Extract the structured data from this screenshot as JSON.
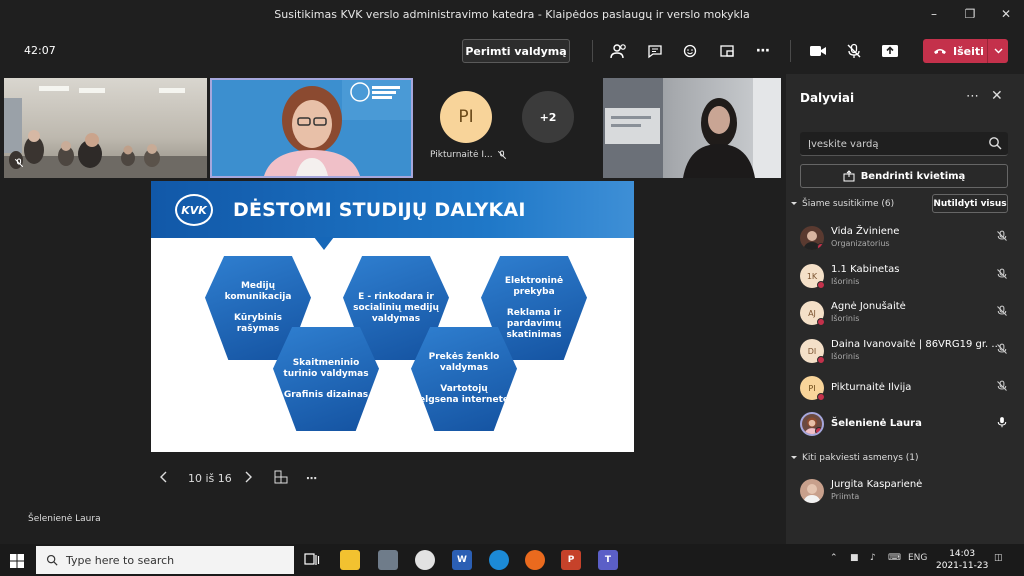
{
  "window": {
    "title": "Susitikimas KVK verslo administravimo katedra - Klaipėdos paslaugų ir verslo mokykla"
  },
  "toolbar": {
    "timer": "42:07",
    "take_control_label": "Perimti valdymą",
    "leave_label": "Išeiti"
  },
  "stage": {
    "participant_tiles": [
      {
        "name": "Pikturnaitė I..."
      }
    ],
    "avatar_initials": "PI",
    "overflow_count": "+2",
    "presenter_name": "Šelenienė Laura"
  },
  "slide": {
    "logo": "KVK",
    "title": "DĖSTOMI STUDIJŲ DALYKAI",
    "hexagons": [
      {
        "lines": [
          "Medijų komunikacija",
          "Kūrybinis rašymas"
        ]
      },
      {
        "lines": [
          "E - rinkodara ir socialinių medijų valdymas"
        ]
      },
      {
        "lines": [
          "Elektroninė prekyba",
          "Reklama ir pardavimų skatinimas"
        ]
      },
      {
        "lines": [
          "Skaitmeninio turinio valdymas",
          "Grafinis dizainas"
        ]
      },
      {
        "lines": [
          "Prekės ženklo valdymas",
          "Vartotojų elgsena internete"
        ]
      }
    ],
    "counter": "10 iš 16"
  },
  "panel": {
    "title": "Dalyviai",
    "search_placeholder": "Įveskite vardą",
    "share_label": "Bendrinti kvietimą",
    "in_meeting_label": "Šiame susitikime (6)",
    "mute_all_label": "Nutildyti visus",
    "others_label": "Kiti pakviesti asmenys (1)",
    "participants": [
      {
        "initials": "",
        "name": "Vida Žviniene",
        "role": "Organizatorius",
        "avatar_color": "#5a3a30"
      },
      {
        "initials": "1K",
        "name": "1.1 Kabinetas",
        "role": "Išorinis",
        "avatar_color": "#f4e0c8"
      },
      {
        "initials": "AJ",
        "name": "Agnė Jonušaitė",
        "role": "Išorinis",
        "avatar_color": "#f4e0c8"
      },
      {
        "initials": "DI",
        "name": "Daina Ivanovaitė | 86VRG19 gr. ...",
        "role": "Išorinis",
        "avatar_color": "#f4e0c8"
      },
      {
        "initials": "PI",
        "name": "Pikturnaitė Ilvija",
        "role": "",
        "avatar_color": "#f8d49a"
      },
      {
        "initials": "",
        "name": "Šelenienė Laura",
        "role": "",
        "avatar_color": "#6b4a40"
      }
    ],
    "invited": [
      {
        "initials": "",
        "name": "Jurgita Kasparienė",
        "role": "Priimta",
        "avatar_color": "#c8a08c"
      }
    ]
  },
  "taskbar": {
    "search_placeholder": "Type here to search",
    "language": "ENG",
    "time": "14:03",
    "date": "2021-11-23"
  }
}
